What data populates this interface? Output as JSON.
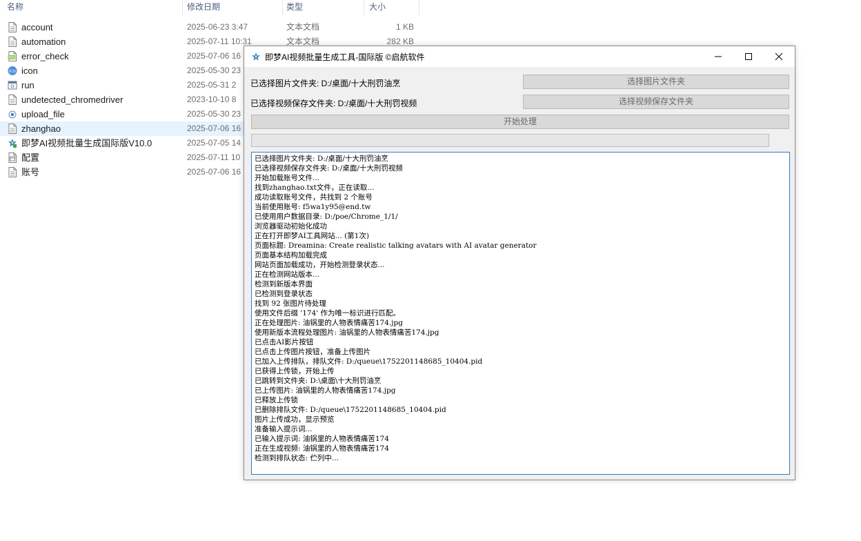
{
  "explorer": {
    "columns": {
      "name": "名称",
      "date": "修改日期",
      "type": "类型",
      "size": "大小"
    },
    "files": [
      {
        "name": "account",
        "date": "2025-06-23 3:47",
        "type": "文本文档",
        "size": "1 KB",
        "icon": "text-file-icon"
      },
      {
        "name": "automation",
        "date": "2025-07-11 10:31",
        "type": "文本文档",
        "size": "282 KB",
        "icon": "text-file-icon"
      },
      {
        "name": "error_check",
        "date": "2025-07-06 16",
        "type": "",
        "size": "",
        "icon": "png-image-icon"
      },
      {
        "name": "icon",
        "date": "2025-05-30 23",
        "type": "",
        "size": "",
        "icon": "ico-image-icon"
      },
      {
        "name": "run",
        "date": "2025-05-31 2",
        "type": "",
        "size": "",
        "icon": "shortcut-icon"
      },
      {
        "name": "undetected_chromedriver",
        "date": "2023-10-10 8",
        "type": "",
        "size": "",
        "icon": "text-file-icon"
      },
      {
        "name": "upload_file",
        "date": "2025-05-30 23",
        "type": "",
        "size": "",
        "icon": "python-file-icon"
      },
      {
        "name": "zhanghao",
        "date": "2025-07-06 16",
        "type": "",
        "size": "",
        "icon": "text-file-icon"
      },
      {
        "name": "即梦AI视频批量生成国际版V10.0",
        "date": "2025-07-05 14",
        "type": "",
        "size": "",
        "icon": "app-exe-icon"
      },
      {
        "name": "配置",
        "date": "2025-07-11 10",
        "type": "",
        "size": "",
        "icon": "config-file-icon"
      },
      {
        "name": "账号",
        "date": "2025-07-06 16",
        "type": "",
        "size": "",
        "icon": "text-file-icon"
      }
    ]
  },
  "app": {
    "title": "即梦AI视频批量生成工具-国际版 ©启航软件",
    "image_folder_label": "已选择图片文件夹: D:/桌面/十大刑罚油烹",
    "video_folder_label": "已选择视频保存文件夹: D:/桌面/十大刑罚视频",
    "select_image_button": "选择图片文件夹",
    "select_video_button": "选择视频保存文件夹",
    "start_button": "开始处理",
    "progress_fraction": 0,
    "log_lines": [
      "已选择图片文件夹: D:/桌面/十大刑罚油烹",
      "已选择视频保存文件夹: D:/桌面/十大刑罚视频",
      "开始加载账号文件...",
      "找到zhanghao.txt文件，正在读取...",
      "成功读取账号文件，共找到 2 个账号",
      "当前使用账号: f5wa1y95@end.tw",
      "已使用用户数据目录: D:/poe/Chrome_1/1/",
      "浏览器驱动初始化成功",
      "正在打开即梦AI工具网站... (第1次)",
      "页面标题: Dreamina: Create realistic talking avatars with AI avatar generator",
      "页面基本结构加载完成",
      "网站页面加载成功，开始检测登录状态...",
      "正在检测网站版本...",
      "检测到新版本界面",
      "已检测到登录状态",
      "找到 92 张图片待处理",
      "使用文件后缀 '174' 作为唯一标识进行匹配。",
      "正在处理图片: 油锅里的人物表情痛苦174.jpg",
      "使用新版本流程处理图片: 油锅里的人物表情痛苦174.jpg",
      "已点击AI影片按钮",
      "已点击上传图片按钮，准备上传图片",
      "已加入上传排队，排队文件: D:/queue\\1752201148685_10404.pid",
      "已获得上传锁，开始上传",
      "已跳转到文件夹: D:\\桌面\\十大刑罚油烹",
      "已上传图片: 油锅里的人物表情痛苦174.jpg",
      "已释放上传锁",
      "已删除排队文件: D:/queue\\1752201148685_10404.pid",
      "图片上传成功，显示预览",
      "准备输入提示词...",
      "已输入提示词: 油锅里的人物表情痛苦174",
      "正在生成视频: 油锅里的人物表情痛苦174",
      "检测到排队状态: 伫列中..."
    ]
  },
  "colors": {
    "accent": "#2f7bc4",
    "selected_row": "#e5f3ff",
    "button_bg": "#d9d9d9",
    "window_bg": "#f0f0f0"
  }
}
